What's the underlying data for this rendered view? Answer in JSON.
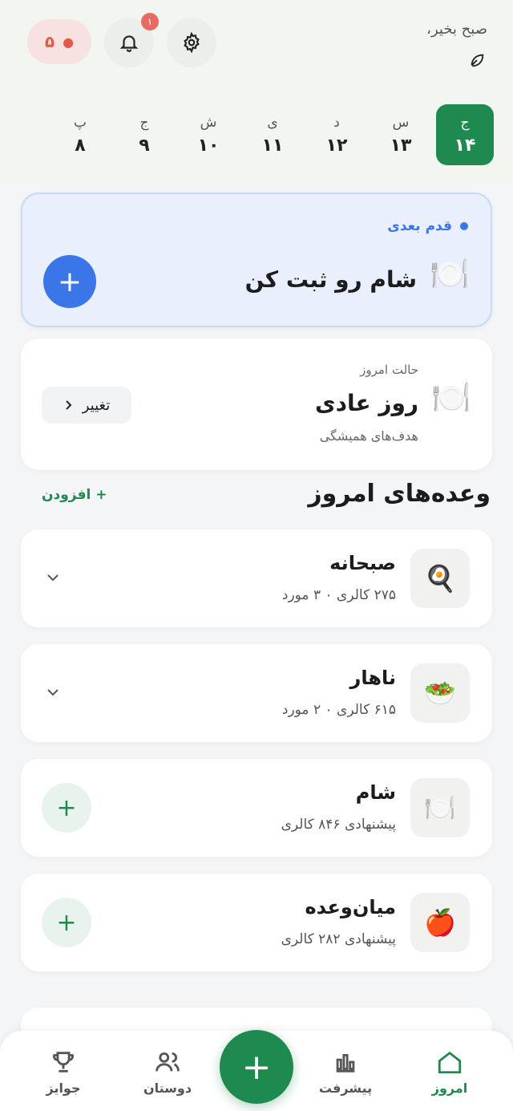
{
  "header": {
    "greeting": "صبح بخیر،",
    "streak": "۵",
    "notifications_count": "۱"
  },
  "days": [
    {
      "letter": "ج",
      "num": "۱۴",
      "active": true
    },
    {
      "letter": "س",
      "num": "۱۳"
    },
    {
      "letter": "د",
      "num": "۱۲"
    },
    {
      "letter": "ی",
      "num": "۱۱"
    },
    {
      "letter": "ش",
      "num": "۱۰"
    },
    {
      "letter": "ج",
      "num": "۹"
    },
    {
      "letter": "پ",
      "num": "۸"
    }
  ],
  "next_step": {
    "label": "قدم بعدی",
    "title": "شام رو ثبت کن"
  },
  "status": {
    "small": "حالت امروز",
    "title": "روز عادی",
    "subtitle": "هدف‌های همیشگی",
    "change_label": "تغییر"
  },
  "meals_section": {
    "title": "وعده‌های امروز",
    "add_label": "+ افزودن"
  },
  "meals": [
    {
      "name": "صبحانه",
      "info": "۲۷۵ کالری ۰ ۳ مورد",
      "icon": "fried-egg-icon"
    },
    {
      "name": "ناهار",
      "info": "۶۱۵ کالری ۰ ۲ مورد",
      "icon": "salad-icon"
    },
    {
      "name": "شام",
      "info": "پیشنهادی ۸۴۶ کالری",
      "icon": "plate-icon"
    },
    {
      "name": "میان‌وعده",
      "info": "پیشنهادی ۲۸۲ کالری",
      "icon": "apple-icon"
    }
  ],
  "nav": {
    "today": "امروز",
    "progress": "پیشرفت",
    "friends": "دوستان",
    "rewards": "جوایز"
  },
  "colors": {
    "primary_green": "#1f8a4f",
    "accent_blue": "#3b76e8",
    "streak_red": "#e05a4e"
  }
}
